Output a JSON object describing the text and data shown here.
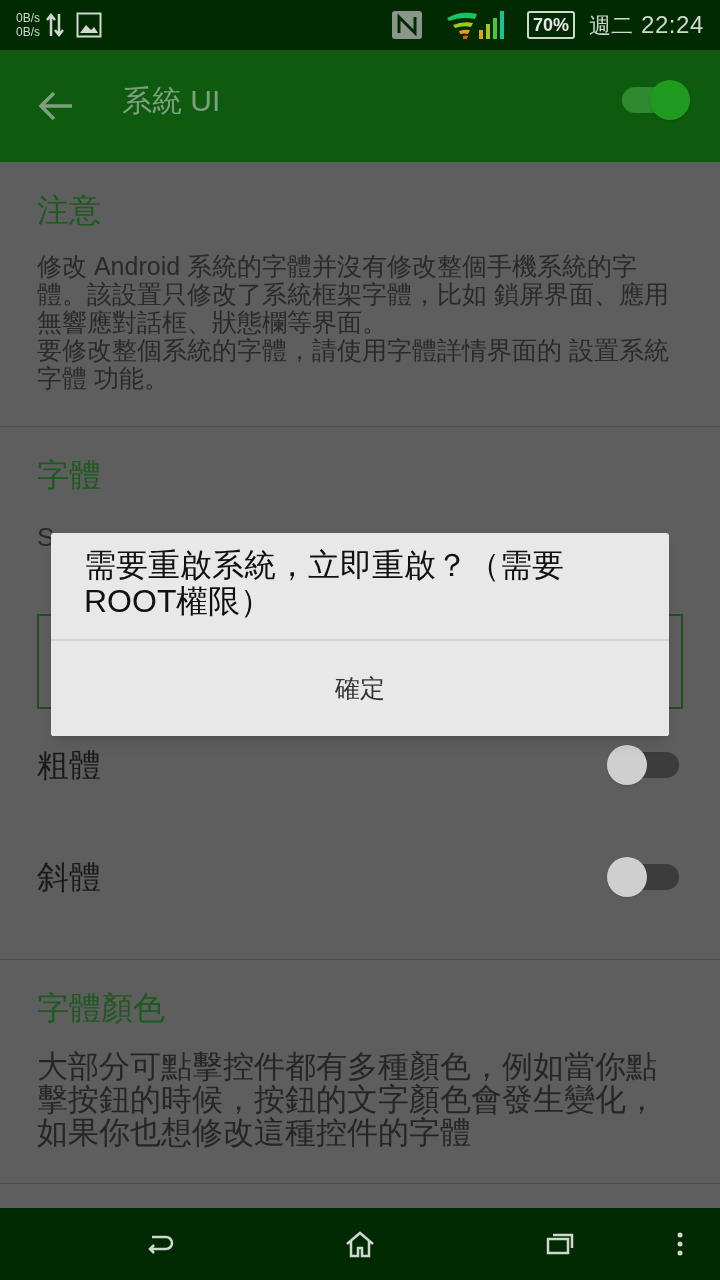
{
  "status_bar": {
    "net_up": "0B/s",
    "net_down": "0B/s",
    "battery": "70%",
    "day": "週二",
    "time": "22:24"
  },
  "app_bar": {
    "title": "系統 UI",
    "toggle": {
      "on": true
    }
  },
  "sections": [
    {
      "kind": "note",
      "title": "注意",
      "paragraphs": [
        "修改 Android 系統的字體并沒有修改整個手機系統的字體。該設置只修改了系統框架字體，比如 鎖屏界面、應用無響應對話框、狀態欄等界面。",
        "要修改整個系統的字體，請使用字體詳情界面的 設置系統字體 功能。"
      ]
    },
    {
      "kind": "font",
      "title": "字體",
      "lines": [
        "S"
      ],
      "switches": [
        {
          "label": "粗體",
          "on": false
        },
        {
          "label": "斜體",
          "on": false
        }
      ]
    },
    {
      "kind": "color",
      "title": "字體顏色",
      "paragraphs": [
        "大部分可點擊控件都有多種顏色，例如當你點擊按鈕的時候，按鈕的文字顏色會發生變化，如果你也想修改這種控件的字體"
      ]
    }
  ],
  "dialog": {
    "message": "需要重啟系統，立即重啟？（需要ROOT權限）",
    "button": "確定"
  }
}
